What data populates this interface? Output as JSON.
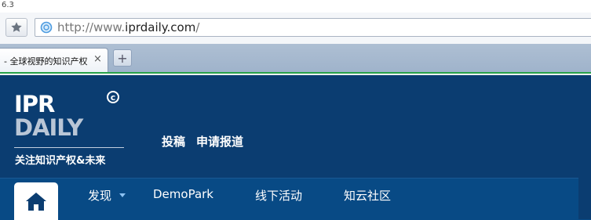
{
  "browser": {
    "version": "6.3",
    "url_scheme": "http://www.",
    "url_host": "iprdaily.com",
    "url_path": "/",
    "tab_title": "- 全球视野的知识产权",
    "tab_close": "×",
    "new_tab": "+",
    "colors": {
      "tab_strip": "#a6b8ce",
      "loading_line": "#2aa34a"
    }
  },
  "site": {
    "logo_ipr": "IPR",
    "logo_daily": "DAILY",
    "logo_copyright": "c",
    "tagline": "关注知识产权&未来",
    "header_links": [
      "投稿",
      "申请报道"
    ],
    "nav_items": [
      "发现",
      "DemoPark",
      "线下活动",
      "知云社区"
    ],
    "colors": {
      "header_bg": "#0b3d71",
      "nav_bg": "#084a85"
    }
  }
}
